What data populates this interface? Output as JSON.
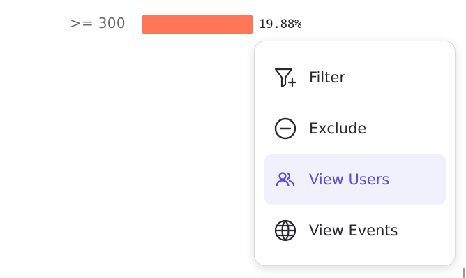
{
  "row": {
    "label": ">= 300",
    "percent_text": "19.88%",
    "bar_color": "#ff7557"
  },
  "menu": {
    "items": [
      {
        "label": "Filter",
        "icon": "filter-plus-icon",
        "active": false
      },
      {
        "label": "Exclude",
        "icon": "minus-circle-icon",
        "active": false
      },
      {
        "label": "View Users",
        "icon": "users-icon",
        "active": true
      },
      {
        "label": "View Events",
        "icon": "globe-icon",
        "active": false
      }
    ],
    "active_bg": "#f1f0fd",
    "active_color": "#5b4fd9"
  }
}
